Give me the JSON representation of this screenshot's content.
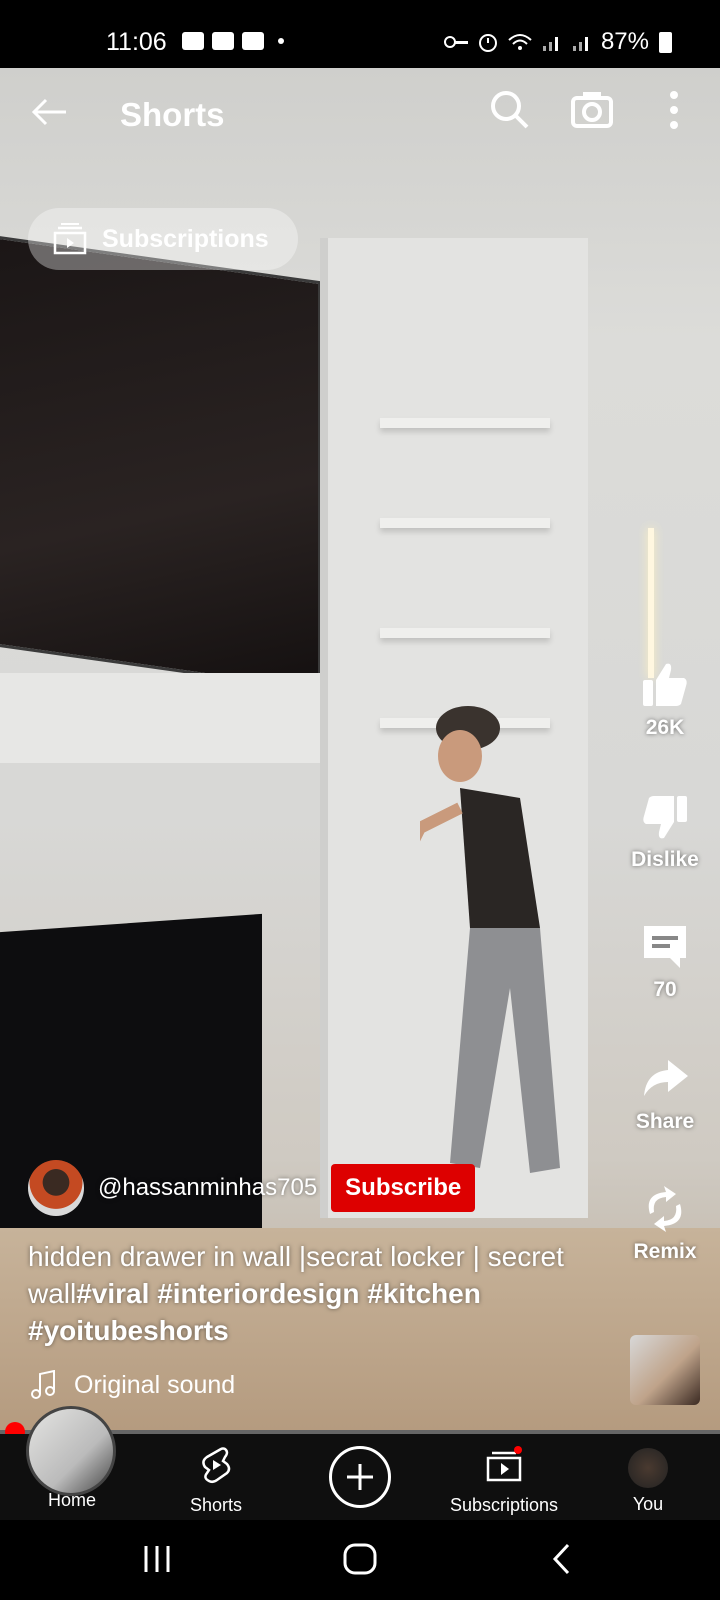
{
  "status_bar": {
    "time": "11:06",
    "battery": "87%"
  },
  "header": {
    "title": "Shorts"
  },
  "chip": {
    "label": "Subscriptions"
  },
  "actions": {
    "like_count": "26K",
    "dislike_label": "Dislike",
    "comment_count": "70",
    "share_label": "Share",
    "remix_label": "Remix"
  },
  "video": {
    "channel_handle": "@hassanminhas705",
    "subscribe_label": "Subscribe",
    "caption_text": "hidden drawer in wall |secrat locker | secret wall",
    "hashtags": [
      "#viral",
      "#interiordesign",
      "#kitchen",
      "#yoitubeshorts"
    ],
    "sound_label": "Original sound"
  },
  "bottom_nav": {
    "home": "Home",
    "shorts": "Shorts",
    "subscriptions": "Subscriptions",
    "you": "You"
  },
  "icons": [
    "back-arrow-icon",
    "search-icon",
    "camera-icon",
    "more-vert-icon",
    "subscriptions-icon",
    "like-icon",
    "dislike-icon",
    "comment-icon",
    "share-icon",
    "remix-icon",
    "music-note-icon",
    "shorts-icon",
    "plus-icon"
  ],
  "colors": {
    "subscribe_red": "#dd0000",
    "progress_dot": "#ff0000",
    "nav_bg": "#0f0f0f"
  }
}
